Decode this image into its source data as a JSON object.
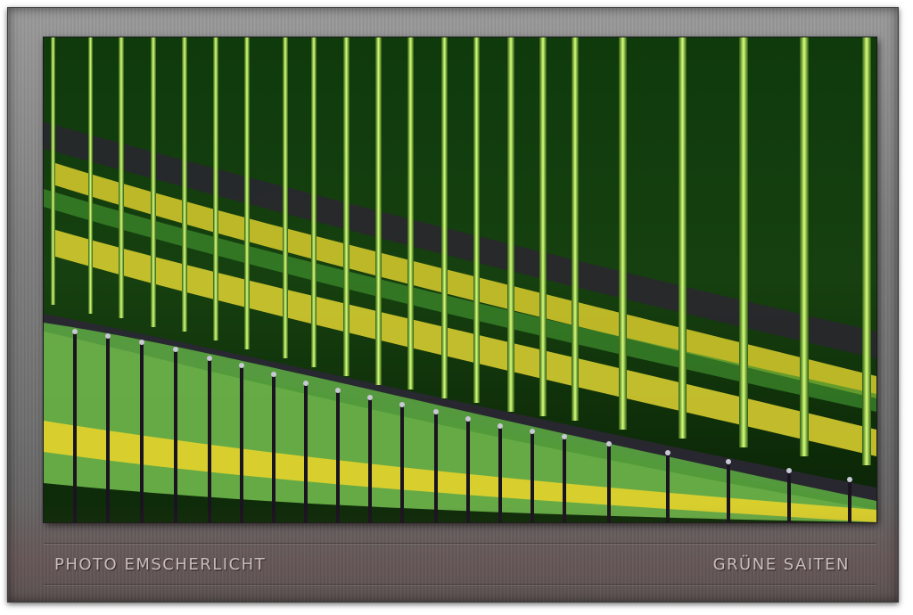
{
  "captions": {
    "left": "PHOTO EMSCHERLICHT",
    "right": "GRÜNE SAITEN"
  },
  "colors": {
    "frame": "#7e7e7e",
    "string_green": "#b7f05a",
    "band_yellow": "#d8cf2e",
    "band_green": "#4f9e3a",
    "background_dark": "#0b2a08"
  }
}
